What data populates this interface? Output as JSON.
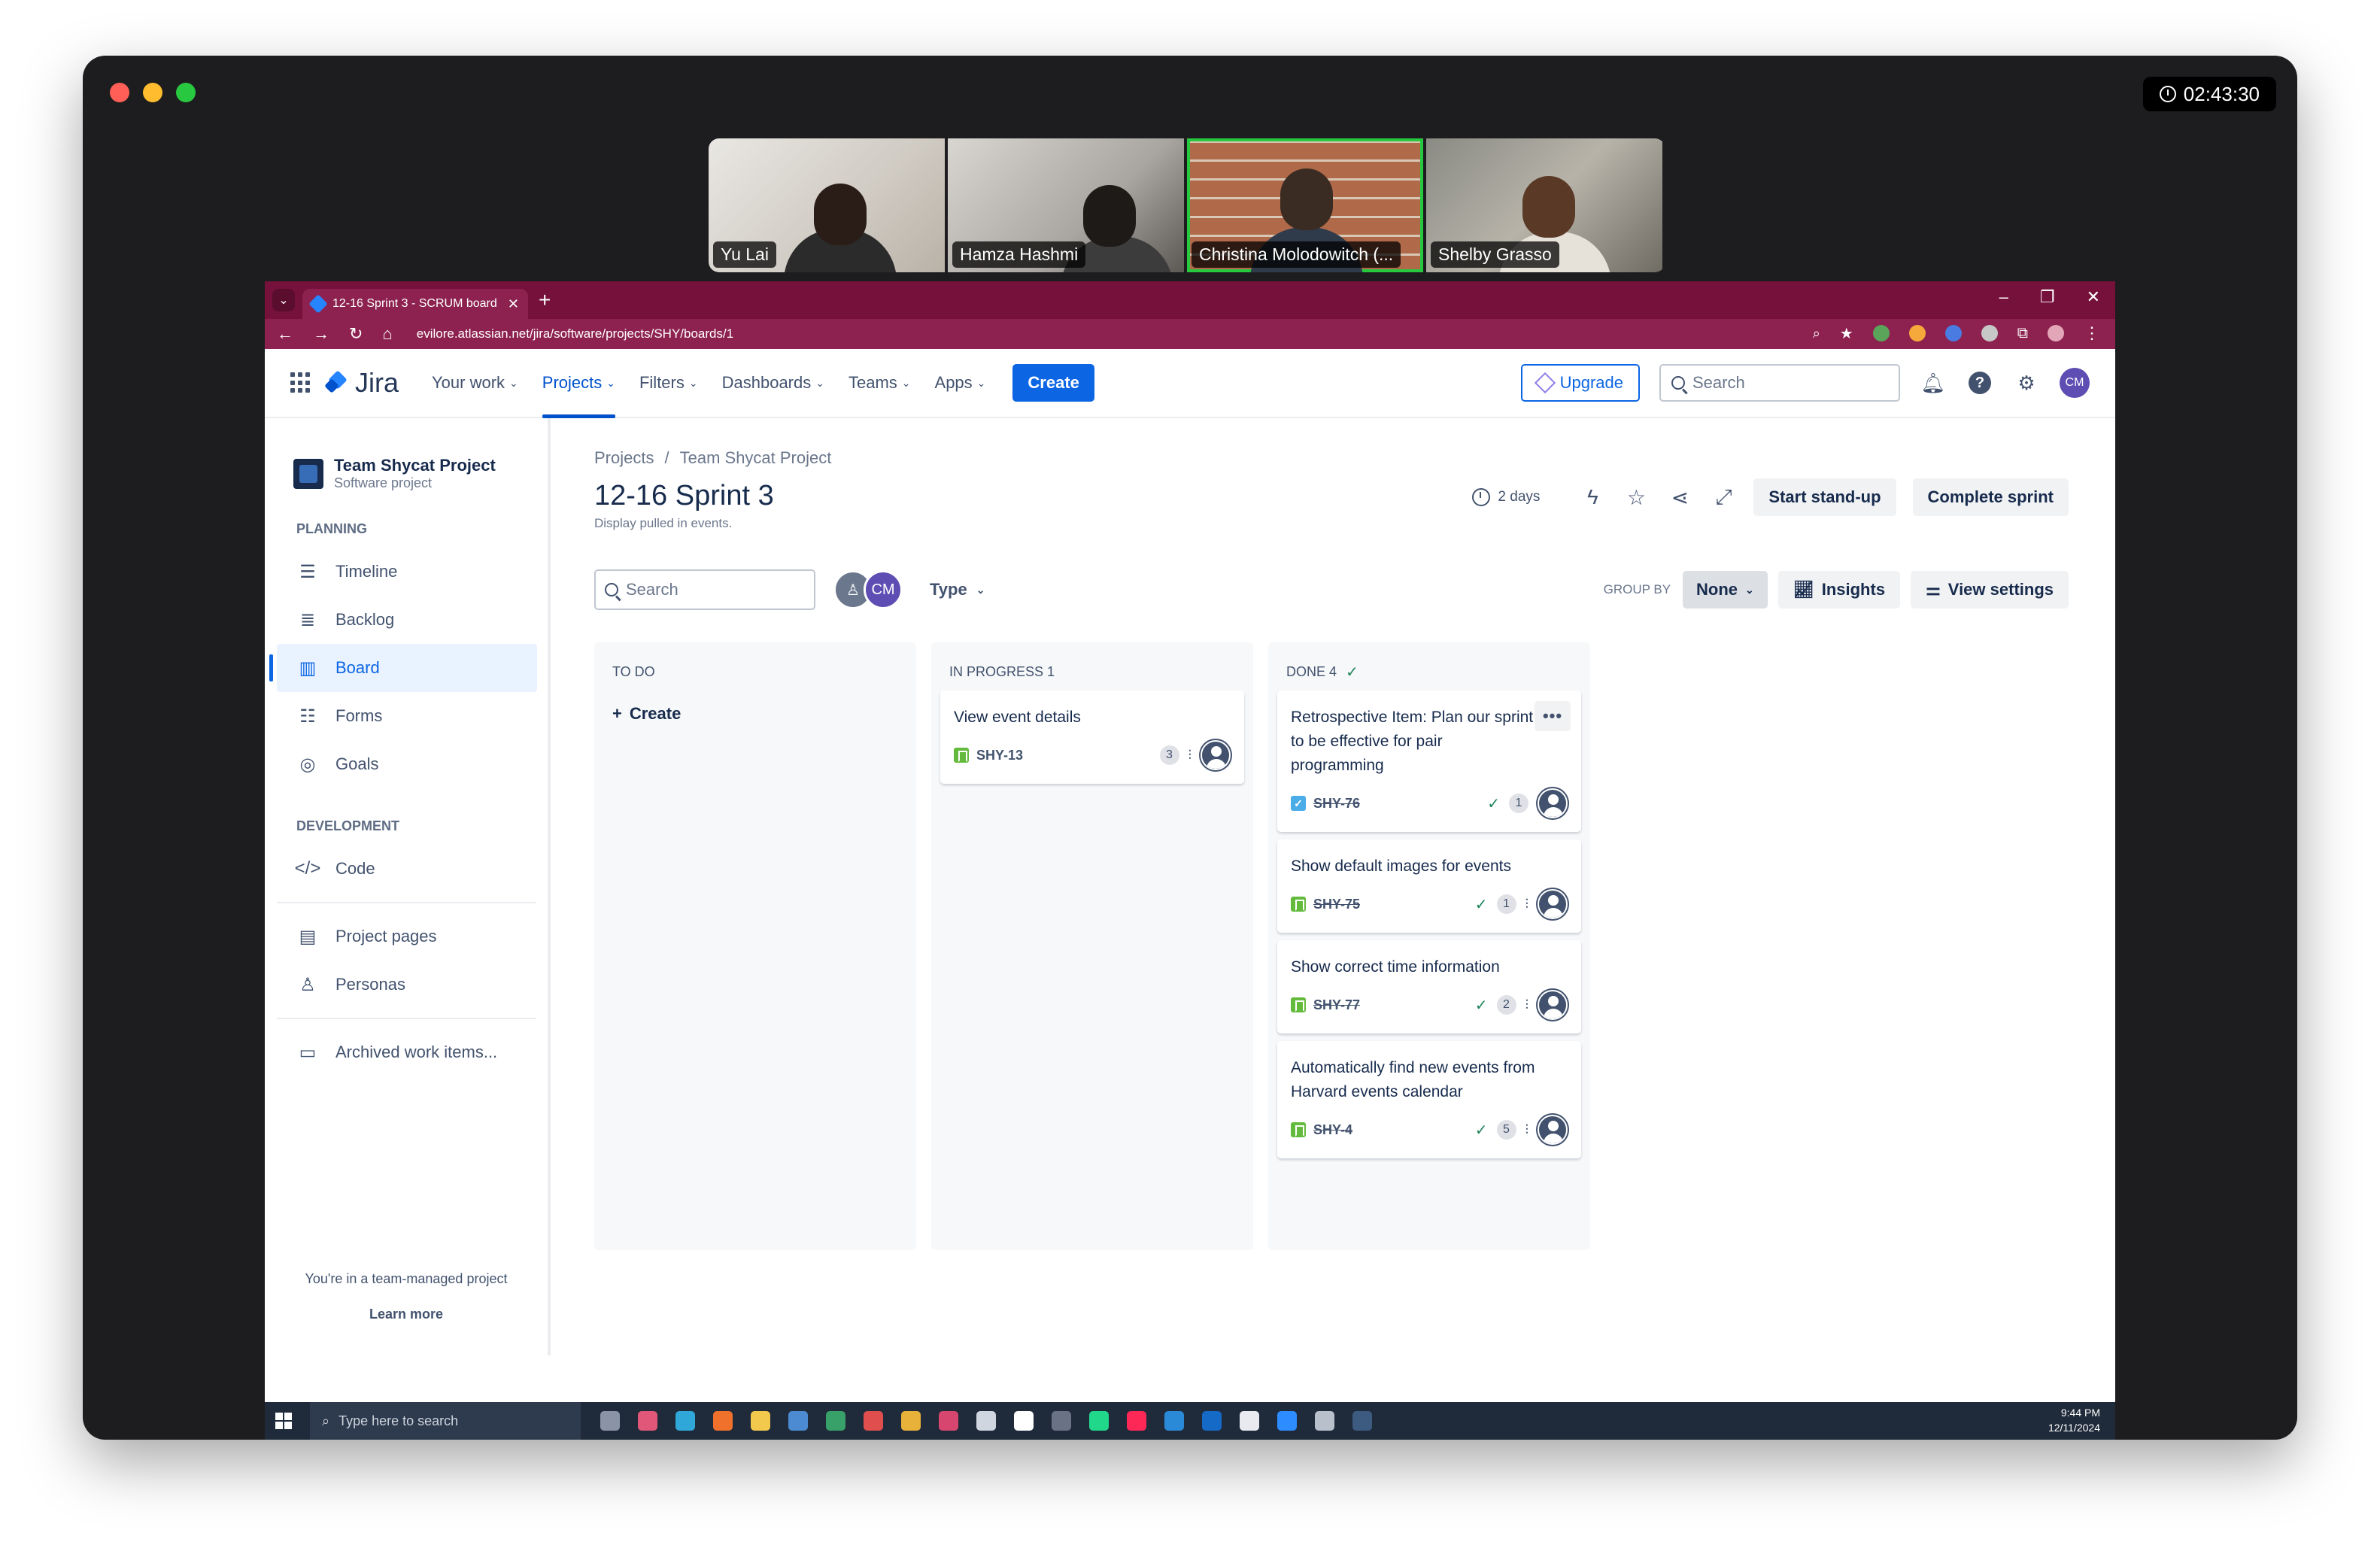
{
  "meeting": {
    "timer": "02:43:30",
    "participants": [
      "Yu Lai",
      "Hamza Hashmi",
      "Christina Molodowitch (...",
      "Shelby Grasso"
    ]
  },
  "browser": {
    "tab_title": "12-16 Sprint 3 - SCRUM board",
    "url": "evilore.atlassian.net/jira/software/projects/SHY/boards/1"
  },
  "topnav": {
    "product": "Jira",
    "menu": [
      "Your work",
      "Projects",
      "Filters",
      "Dashboards",
      "Teams",
      "Apps"
    ],
    "active_menu": "Projects",
    "create": "Create",
    "upgrade": "Upgrade",
    "search_placeholder": "Search",
    "avatar_initials": "CM"
  },
  "sidebar": {
    "project_name": "Team Shycat Project",
    "project_type": "Software project",
    "planning_heading": "PLANNING",
    "planning": [
      "Timeline",
      "Backlog",
      "Board",
      "Forms",
      "Goals"
    ],
    "development_heading": "DEVELOPMENT",
    "development": [
      "Code"
    ],
    "other": [
      "Project pages",
      "Personas"
    ],
    "archived": "Archived work items...",
    "footer_text": "You're in a team-managed project",
    "learn_more": "Learn more"
  },
  "header": {
    "breadcrumb_root": "Projects",
    "breadcrumb_sep": "/",
    "breadcrumb_project": "Team Shycat Project",
    "title": "12-16 Sprint 3",
    "subtitle": "Display pulled in events.",
    "days_remaining": "2 days",
    "start_standup": "Start stand-up",
    "complete_sprint": "Complete sprint"
  },
  "toolbar": {
    "search_placeholder": "Search",
    "avatar_initials": "CM",
    "type_filter": "Type",
    "group_by_label": "GROUP BY",
    "group_by_value": "None",
    "insights": "Insights",
    "view_settings": "View settings"
  },
  "board": {
    "columns": [
      {
        "title": "TO DO",
        "create_label": "Create",
        "cards": []
      },
      {
        "title": "IN PROGRESS 1",
        "cards": [
          {
            "title": "View event details",
            "key": "SHY-13",
            "estimate": "3"
          }
        ]
      },
      {
        "title": "DONE 4",
        "cards": [
          {
            "title": "Retrospective Item: Plan our sprint to be effective for pair programming",
            "key": "SHY-76",
            "estimate": "1"
          },
          {
            "title": "Show default images for events",
            "key": "SHY-75",
            "estimate": "1"
          },
          {
            "title": "Show correct time information",
            "key": "SHY-77",
            "estimate": "2"
          },
          {
            "title": "Automatically find new events from Harvard events calendar",
            "key": "SHY-4",
            "estimate": "5"
          }
        ]
      }
    ]
  },
  "taskbar": {
    "search_placeholder": "Type here to search",
    "time": "9:44 PM",
    "date": "12/11/2024"
  },
  "colors": {
    "brand_blue": "#0c66e4",
    "browser_chrome": "#75113a",
    "done_green": "#1f845a",
    "story_green": "#63ba3c"
  }
}
